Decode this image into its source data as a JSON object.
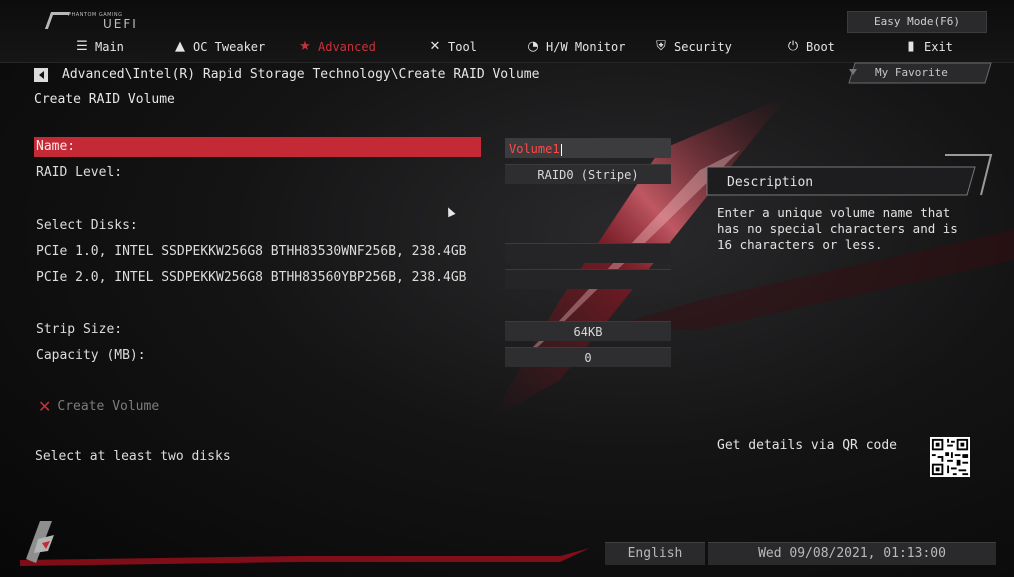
{
  "logo": {
    "small_text": "PHANTOM GAMING",
    "product": "UEFI"
  },
  "header": {
    "easy_mode": "Easy Mode(F6)",
    "tabs": [
      {
        "label": "Main",
        "icon": "list-icon"
      },
      {
        "label": "OC Tweaker",
        "icon": "rocket-icon"
      },
      {
        "label": "Advanced",
        "icon": "star-icon",
        "active": true
      },
      {
        "label": "Tool",
        "icon": "tools-icon"
      },
      {
        "label": "H/W Monitor",
        "icon": "monitor-icon"
      },
      {
        "label": "Security",
        "icon": "shield-icon"
      },
      {
        "label": "Boot",
        "icon": "power-icon"
      },
      {
        "label": "Exit",
        "icon": "exit-icon"
      }
    ],
    "my_favorite": "My Favorite"
  },
  "breadcrumb": "Advanced\\Intel(R) Rapid Storage Technology\\Create RAID Volume",
  "page_title": "Create RAID Volume",
  "form": {
    "name_label": "Name:",
    "name_value": "Volume1",
    "raid_label": "RAID Level:",
    "raid_value": "RAID0 (Stripe)",
    "select_disks_label": "Select Disks:",
    "disks": [
      {
        "label": "PCIe 1.0, INTEL SSDPEKKW256G8 BTHH83530WNF256B, 238.4GB",
        "value": ""
      },
      {
        "label": "PCIe 2.0, INTEL SSDPEKKW256G8 BTHH83560YBP256B, 238.4GB",
        "value": ""
      }
    ],
    "strip_label": "Strip Size:",
    "strip_value": "64KB",
    "capacity_label": "Capacity (MB):",
    "capacity_value": "0",
    "create_label": "Create Volume",
    "status": "Select at least two disks"
  },
  "description": {
    "title": "Description",
    "text": "Enter a unique volume name that has no special characters and is 16 characters or less.",
    "qr_label": "Get details via QR code"
  },
  "footer": {
    "language": "English",
    "datetime": "Wed 09/08/2021, 01:13:00"
  },
  "colors": {
    "accent": "#c42a35",
    "active_tab": "#c7323a",
    "background": "#141415"
  }
}
